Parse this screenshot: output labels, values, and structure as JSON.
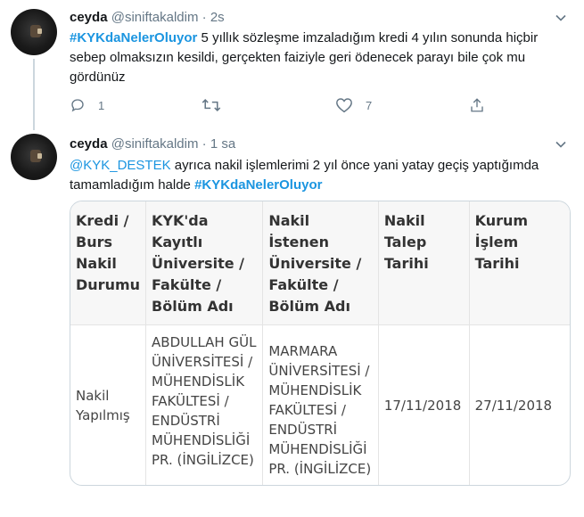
{
  "tweets": [
    {
      "name": "ceyda",
      "handle": "@siniftakaldim",
      "time": "2s",
      "hashtag": "#KYKdaNelerOluyor",
      "text": " 5 yıllık sözleşme imzaladığım kredi 4 yılın sonunda hiçbir sebep olmaksızın kesildi, gerçekten faiziyle geri ödenecek parayı bile çok mu gördünüz",
      "replies": "1",
      "retweets": "",
      "likes": "7"
    },
    {
      "name": "ceyda",
      "handle": "@siniftakaldim",
      "time": "1 sa",
      "mention": "@KYK_DESTEK",
      "text": " ayrıca nakil işlemlerimi 2 yıl önce yani yatay geçiş yaptığımda tamamladığım halde ",
      "hashtag": "#KYKdaNelerOluyor"
    }
  ],
  "card_table": {
    "headers": [
      "Kredi / Burs Nakil Durumu",
      "KYK'da Kayıtlı Üniversite / Fakülte / Bölüm Adı",
      "Nakil İstenen Üniversite / Fakülte / Bölüm Adı",
      "Nakil Talep Tarihi",
      "Kurum İşlem Tarihi"
    ],
    "row": [
      "Nakil Yapılmış",
      "ABDULLAH GÜL ÜNİVERSİTESİ / MÜHENDİSLİK FAKÜLTESİ / ENDÜSTRİ MÜHENDİSLİĞİ PR. (İNGİLİZCE)",
      "MARMARA ÜNİVERSİTESİ / MÜHENDİSLİK FAKÜLTESİ / ENDÜSTRİ MÜHENDİSLİĞİ PR. (İNGİLİZCE)",
      "17/11/2018",
      "27/11/2018"
    ]
  },
  "colors": {
    "accent": "#1b95e0",
    "muted": "#657786",
    "text": "#14171a"
  }
}
